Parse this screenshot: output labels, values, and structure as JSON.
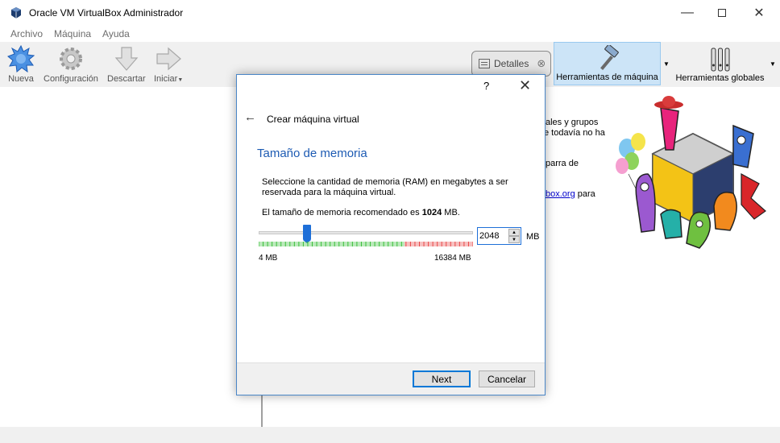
{
  "window": {
    "title": "Oracle VM VirtualBox Administrador"
  },
  "menu": {
    "items": [
      "Archivo",
      "Máquina",
      "Ayuda"
    ]
  },
  "toolbar": {
    "new_label": "Nueva",
    "settings_label": "Configuración",
    "discard_label": "Descartar",
    "start_label": "Iniciar"
  },
  "views": {
    "details_label": "Detalles",
    "machine_tools_label": "Herramientas de máquina",
    "global_tools_label": "Herramientas globales"
  },
  "welcome": {
    "line1": "ales y grupos",
    "line2": "e todavía no ha",
    "line3": "parra de",
    "link": "box.org",
    "line4": "para"
  },
  "dialog": {
    "title": "Crear máquina virtual",
    "help": "?",
    "section_title": "Tamaño de memoria",
    "description_line1": "Seleccione la cantidad de memoria (RAM) en megabytes a ser",
    "description_line2": "reservada para la máquina virtual.",
    "recommended_prefix": "El tamaño de memoria recomendado es",
    "recommended_value": "1024",
    "recommended_suffix": "MB.",
    "memory": {
      "value": "2048",
      "min": 4,
      "max": 16384,
      "current": 2048,
      "recommended": 1024,
      "green_until": 0.68,
      "orange_until": 0.68,
      "red_from": 0.68
    },
    "min_label": "4 MB",
    "max_label": "16384 MB",
    "unit": "MB",
    "next_label": "Next",
    "cancel_label": "Cancelar"
  },
  "colors": {
    "accent": "#0078d7",
    "section_title": "#1d5bb3",
    "selected_tool_bg": "#cce4f7"
  }
}
